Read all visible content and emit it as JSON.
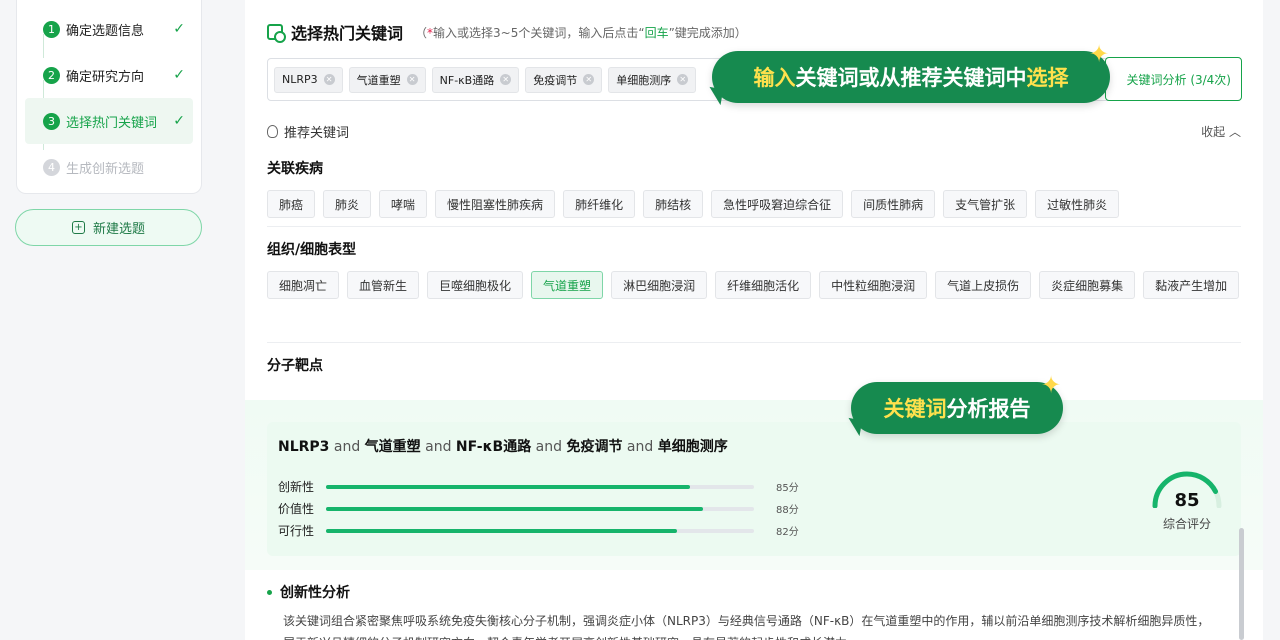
{
  "steps": [
    {
      "num": "1",
      "label": "确定选题信息",
      "status": "done"
    },
    {
      "num": "2",
      "label": "确定研究方向",
      "status": "done"
    },
    {
      "num": "3",
      "label": "选择热门关键词",
      "status": "active"
    },
    {
      "num": "4",
      "label": "生成创新选题",
      "status": "pending"
    }
  ],
  "new_topic_label": "新建选题",
  "header": {
    "title": "选择热门关键词",
    "hint_open": "（",
    "hint_star": "*",
    "hint_a": "输入或选择3~5个关键词，输入后点击“",
    "hint_enter": "回车",
    "hint_b": "”键完成添加）"
  },
  "selected_tags": [
    "NLRP3",
    "气道重塑",
    "NF-κB通路",
    "免疫调节",
    "单细胞测序"
  ],
  "analyze_button": "关键词分析 (3/4次)",
  "banner_top": {
    "a": "输入",
    "b": "关键词或从推荐关键词中",
    "c": "选择"
  },
  "recommend": {
    "label": "推荐关键词",
    "collapse": "收起"
  },
  "sections": [
    {
      "title": "关联疾病",
      "chips": [
        "肺癌",
        "肺炎",
        "哮喘",
        "慢性阻塞性肺疾病",
        "肺纤维化",
        "肺结核",
        "急性呼吸窘迫综合征",
        "间质性肺病",
        "支气管扩张",
        "过敏性肺炎"
      ]
    },
    {
      "title": "组织/细胞表型",
      "chips": [
        "细胞凋亡",
        "血管新生",
        "巨噬细胞极化",
        "气道重塑",
        "淋巴细胞浸润",
        "纤维细胞活化",
        "中性粒细胞浸润",
        "气道上皮损伤",
        "炎症细胞募集",
        "黏液产生增加"
      ],
      "selected": "气道重塑"
    },
    {
      "title": "分子靶点"
    }
  ],
  "banner_report": {
    "a": "关键词",
    "b": "分析报告"
  },
  "report": {
    "query": [
      "NLRP3",
      "气道重塑",
      "NF-κB通路",
      "免疫调节",
      "单细胞测序"
    ],
    "and_word": "and",
    "metrics": [
      {
        "label": "创新性",
        "value": 85,
        "score": "85分"
      },
      {
        "label": "价值性",
        "value": 88,
        "score": "88分"
      },
      {
        "label": "可行性",
        "value": 82,
        "score": "82分"
      }
    ],
    "overall_score": "85",
    "overall_value": 85,
    "overall_label": "综合评分",
    "analysis_title": "创新性分析",
    "analysis_line1": "该关键词组合紧密聚焦呼吸系统免疫失衡核心分子机制，强调炎症小体（NLRP3）与经典信号通路（NF-κB）在气道重塑中的作用，辅以前沿单细胞测序技术解析细胞异质性，",
    "analysis_line2": "属于新兴且精细的分子机制研究方向，契合青年学者开展高创新性基础研究，具有显著的起步性和成长潜力。"
  },
  "colors": {
    "accent": "#16a34a",
    "banner": "#168a4f",
    "highlight": "#ffe14d"
  }
}
